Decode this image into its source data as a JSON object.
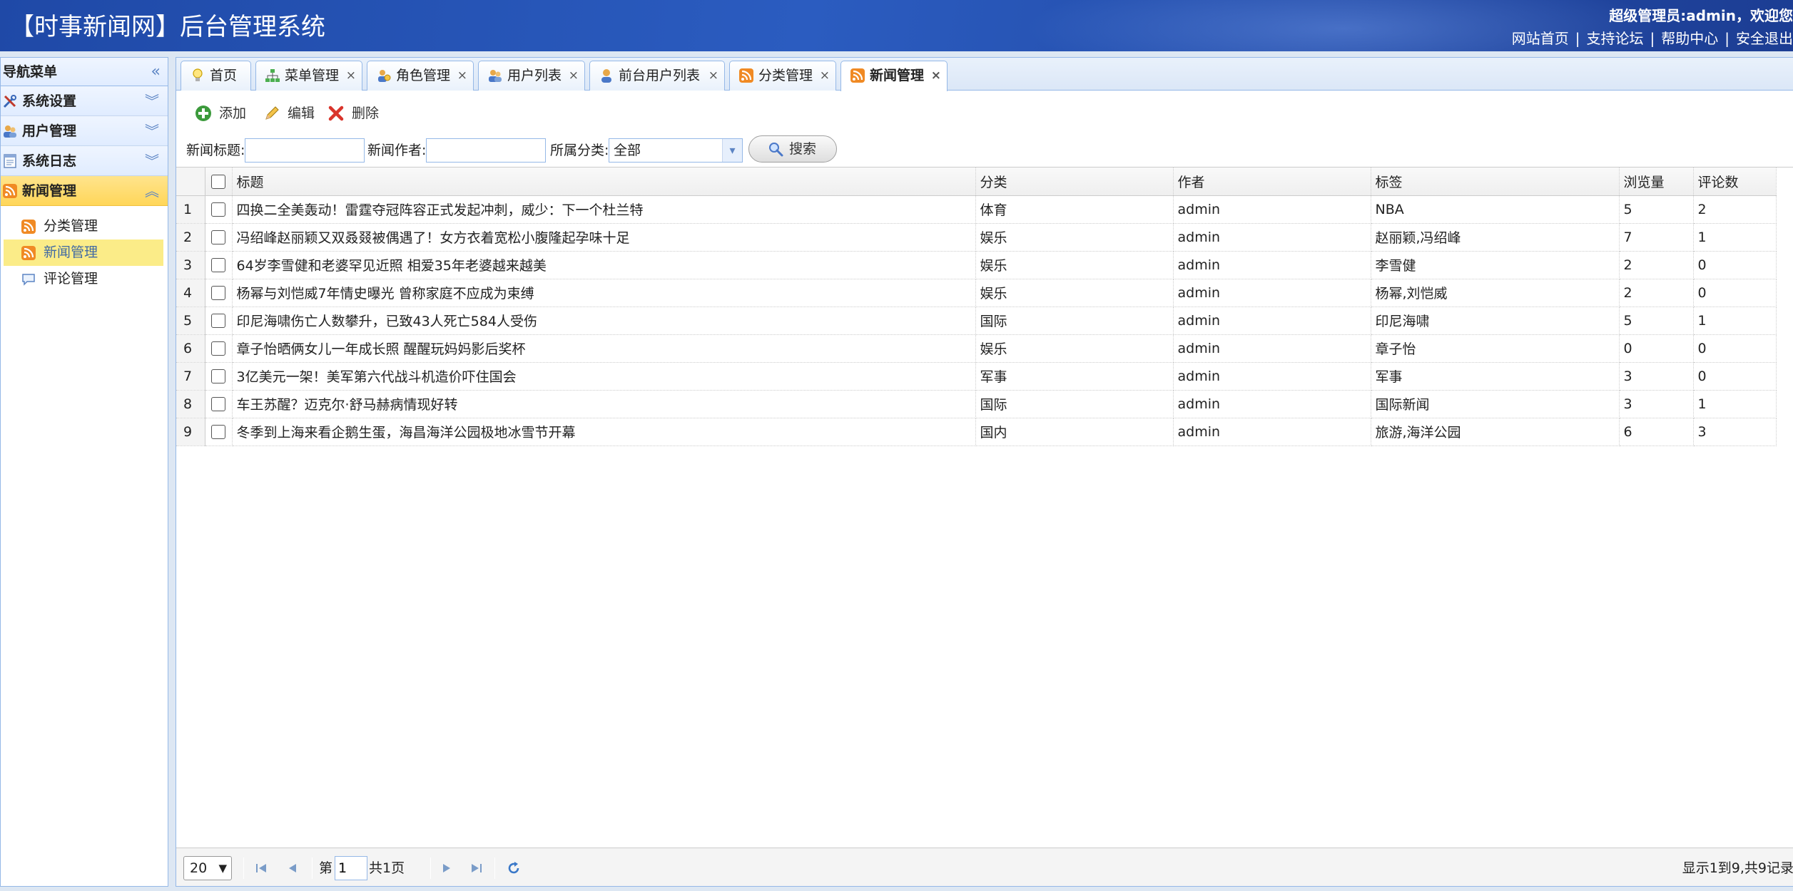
{
  "header": {
    "title": "【时事新闻网】后台管理系统",
    "admin_info": "超级管理员:admin，欢迎您",
    "links": [
      "网站首页",
      "支持论坛",
      "帮助中心",
      "安全退出"
    ]
  },
  "sidebar": {
    "title": "导航菜单",
    "groups": [
      {
        "label": "系统设置",
        "icon": "tools-icon"
      },
      {
        "label": "用户管理",
        "icon": "users-icon"
      },
      {
        "label": "系统日志",
        "icon": "log-icon"
      },
      {
        "label": "新闻管理",
        "icon": "rss-icon",
        "active": true
      }
    ],
    "subitems": [
      {
        "label": "分类管理",
        "icon": "rss-icon"
      },
      {
        "label": "新闻管理",
        "icon": "rss-icon",
        "active": true
      },
      {
        "label": "评论管理",
        "icon": "comment-icon"
      }
    ]
  },
  "tabs": [
    {
      "label": "首页",
      "icon": "bulb-icon",
      "closable": false
    },
    {
      "label": "菜单管理",
      "icon": "sitemap-icon",
      "closable": true
    },
    {
      "label": "角色管理",
      "icon": "role-icon",
      "closable": true
    },
    {
      "label": "用户列表",
      "icon": "users-icon",
      "closable": true
    },
    {
      "label": "前台用户列表",
      "icon": "user-icon",
      "closable": true
    },
    {
      "label": "分类管理",
      "icon": "rss-icon",
      "closable": true
    },
    {
      "label": "新闻管理",
      "icon": "rss-icon",
      "closable": true,
      "active": true
    }
  ],
  "toolbar": {
    "add_label": "添加",
    "edit_label": "编辑",
    "delete_label": "删除"
  },
  "filters": {
    "title_label": "新闻标题:",
    "title_value": "",
    "author_label": "新闻作者:",
    "author_value": "",
    "category_label": "所属分类:",
    "category_value": "全部",
    "search_label": "搜索"
  },
  "grid": {
    "columns": [
      "标题",
      "分类",
      "作者",
      "标签",
      "浏览量",
      "评论数"
    ],
    "rows": [
      {
        "n": "1",
        "title": "四换二全美轰动！雷霆夺冠阵容正式发起冲刺，威少：下一个杜兰特",
        "category": "体育",
        "author": "admin",
        "tags": "NBA",
        "views": "5",
        "comments": "2"
      },
      {
        "n": "2",
        "title": "冯绍峰赵丽颖又双叒叕被偶遇了！女方衣着宽松小腹隆起孕味十足",
        "category": "娱乐",
        "author": "admin",
        "tags": "赵丽颖,冯绍峰",
        "views": "7",
        "comments": "1"
      },
      {
        "n": "3",
        "title": "64岁李雪健和老婆罕见近照 相爱35年老婆越来越美",
        "category": "娱乐",
        "author": "admin",
        "tags": "李雪健",
        "views": "2",
        "comments": "0"
      },
      {
        "n": "4",
        "title": "杨幂与刘恺威7年情史曝光 曾称家庭不应成为束缚",
        "category": "娱乐",
        "author": "admin",
        "tags": "杨幂,刘恺威",
        "views": "2",
        "comments": "0"
      },
      {
        "n": "5",
        "title": "印尼海啸伤亡人数攀升，已致43人死亡584人受伤",
        "category": "国际",
        "author": "admin",
        "tags": "印尼海啸",
        "views": "5",
        "comments": "1"
      },
      {
        "n": "6",
        "title": "章子怡晒俩女儿一年成长照 醒醒玩妈妈影后奖杯",
        "category": "娱乐",
        "author": "admin",
        "tags": "章子怡",
        "views": "0",
        "comments": "0"
      },
      {
        "n": "7",
        "title": "3亿美元一架！美军第六代战斗机造价吓住国会",
        "category": "军事",
        "author": "admin",
        "tags": "军事",
        "views": "3",
        "comments": "0"
      },
      {
        "n": "8",
        "title": "车王苏醒？迈克尔·舒马赫病情现好转",
        "category": "国际",
        "author": "admin",
        "tags": "国际新闻",
        "views": "3",
        "comments": "1"
      },
      {
        "n": "9",
        "title": "冬季到上海来看企鹅生蛋，海昌海洋公园极地冰雪节开幕",
        "category": "国内",
        "author": "admin",
        "tags": "旅游,海洋公园",
        "views": "6",
        "comments": "3"
      }
    ]
  },
  "pager": {
    "page_size": "20",
    "page_prefix": "第",
    "page_value": "1",
    "page_total": "共1页",
    "display_info": "显示1到9,共9记录"
  }
}
